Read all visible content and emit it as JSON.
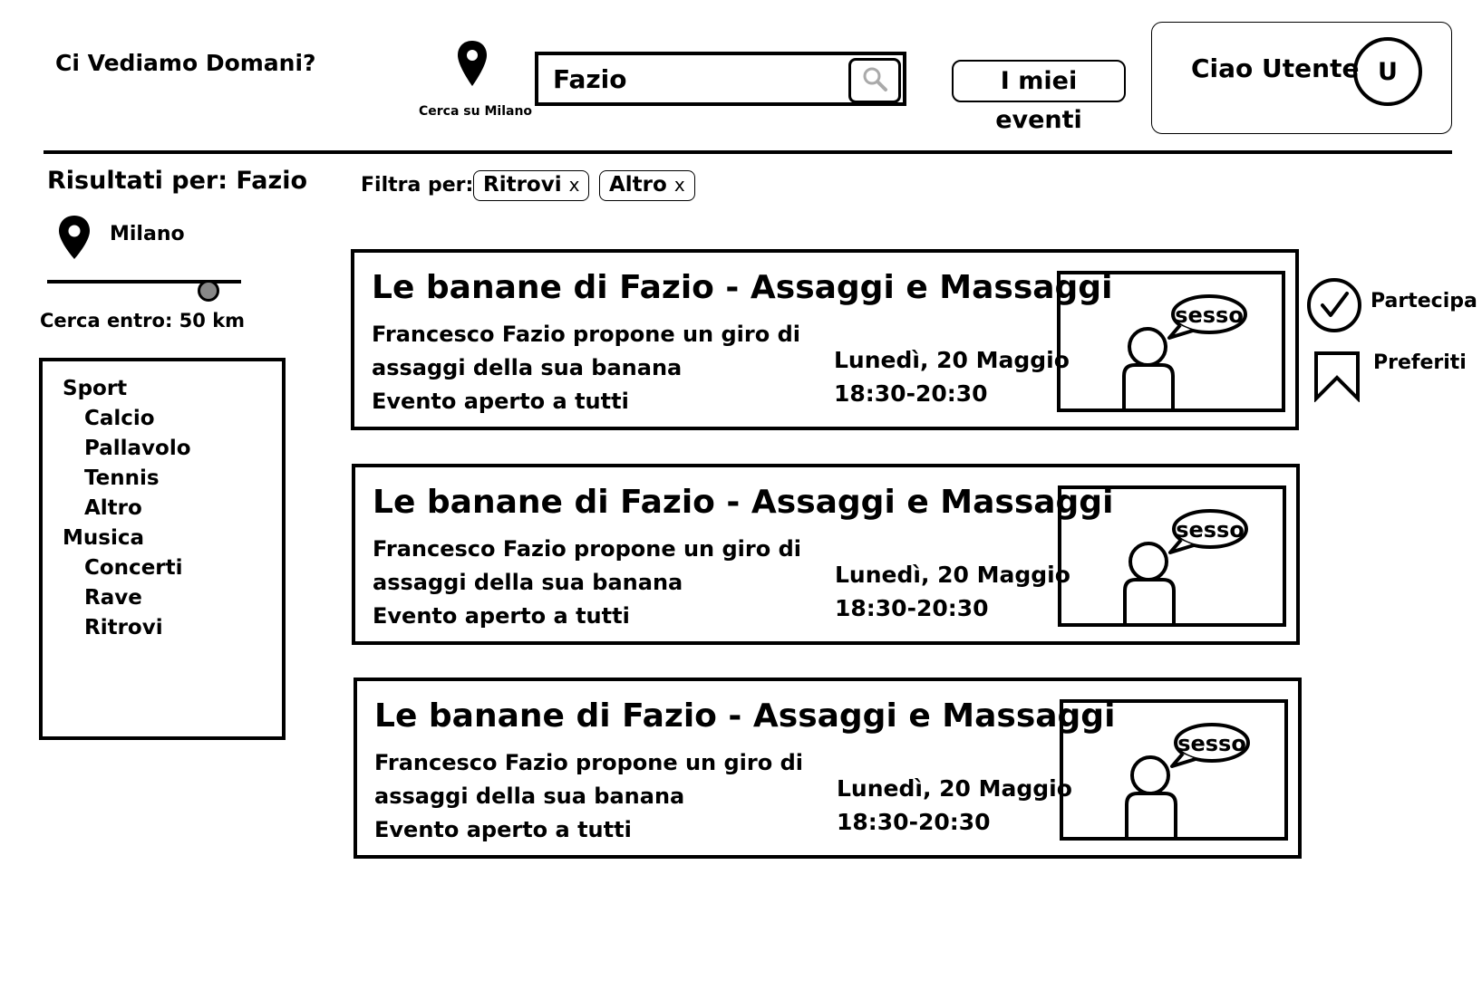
{
  "header": {
    "app_title": "Ci Vediamo Domani?",
    "location_caption": "Cerca su Milano",
    "search_value": "Fazio",
    "my_events_label": "I miei eventi",
    "greeting": "Ciao Utente",
    "avatar_initial": "U"
  },
  "sidebar": {
    "results_title": "Risultati per: Fazio",
    "city": "Milano",
    "radius_label": "Cerca entro: 50 km",
    "radius_km": 50,
    "slider_fraction": 0.82,
    "categories": [
      {
        "label": "Sport",
        "level": 0
      },
      {
        "label": "Calcio",
        "level": 1
      },
      {
        "label": "Pallavolo",
        "level": 1
      },
      {
        "label": "Tennis",
        "level": 1
      },
      {
        "label": "Altro",
        "level": 1
      },
      {
        "label": "Musica",
        "level": 0
      },
      {
        "label": "Concerti",
        "level": 1
      },
      {
        "label": "Rave",
        "level": 1
      },
      {
        "label": "Ritrovi",
        "level": 1
      }
    ]
  },
  "filters": {
    "label": "Filtra per:",
    "chips": [
      {
        "label": "Ritrovi",
        "remove": "x"
      },
      {
        "label": "Altro",
        "remove": "x"
      }
    ]
  },
  "events": [
    {
      "title": "Le banane di Fazio - Assaggi e Massaggi",
      "description_lines": [
        "Francesco Fazio propone un giro di",
        "assaggi della sua banana",
        "Evento aperto a tutti"
      ],
      "date": "Lunedì, 20 Maggio",
      "time": "18:30-20:30",
      "image_bubble": "sesso"
    },
    {
      "title": "Le banane di Fazio - Assaggi e Massaggi",
      "description_lines": [
        "Francesco Fazio propone un giro di",
        "assaggi della sua banana",
        "Evento aperto a tutti"
      ],
      "date": "Lunedì, 20 Maggio",
      "time": "18:30-20:30",
      "image_bubble": "sesso"
    },
    {
      "title": "Le banane di Fazio - Assaggi e Massaggi",
      "description_lines": [
        "Francesco Fazio propone un giro di",
        "assaggi della sua banana",
        "Evento aperto a tutti"
      ],
      "date": "Lunedì, 20 Maggio",
      "time": "18:30-20:30",
      "image_bubble": "sesso"
    }
  ],
  "actions": {
    "participate_label": "Partecipa",
    "favorites_label": "Preferiti"
  },
  "icons": {
    "location": "map-pin-icon",
    "search": "magnifier-icon",
    "participate": "check-circle-icon",
    "favorites": "bookmark-icon"
  }
}
